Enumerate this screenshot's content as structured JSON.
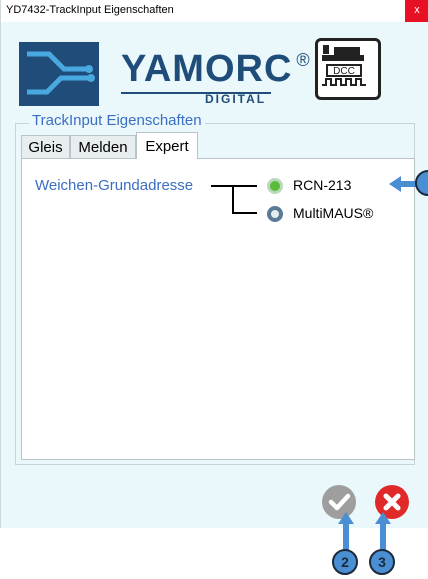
{
  "window": {
    "title": "YD7432-TrackInput Eigenschaften",
    "close_label": "x"
  },
  "logo": {
    "brand": "YAMORC",
    "registered": "®",
    "subtitle": "DIGITAL",
    "dcc_label": "DCC"
  },
  "group": {
    "title": "TrackInput Eigenschaften",
    "tabs": [
      {
        "label": "Gleis",
        "active": false
      },
      {
        "label": "Melden",
        "active": false
      },
      {
        "label": "Expert",
        "active": true
      }
    ]
  },
  "expert": {
    "field_label": "Weichen-Grundadresse",
    "options": [
      {
        "label": "RCN-213",
        "selected": true
      },
      {
        "label": "MultiMAUS®",
        "selected": false
      }
    ]
  },
  "actions": {
    "ok_icon": "check-icon",
    "cancel_icon": "x-icon"
  },
  "callouts": {
    "ok": "2",
    "cancel": "3"
  },
  "colors": {
    "accent": "#3b6ec3",
    "selected_radio": "#5bbb3a",
    "cancel": "#e02a2a",
    "callout": "#4a8fd4"
  }
}
